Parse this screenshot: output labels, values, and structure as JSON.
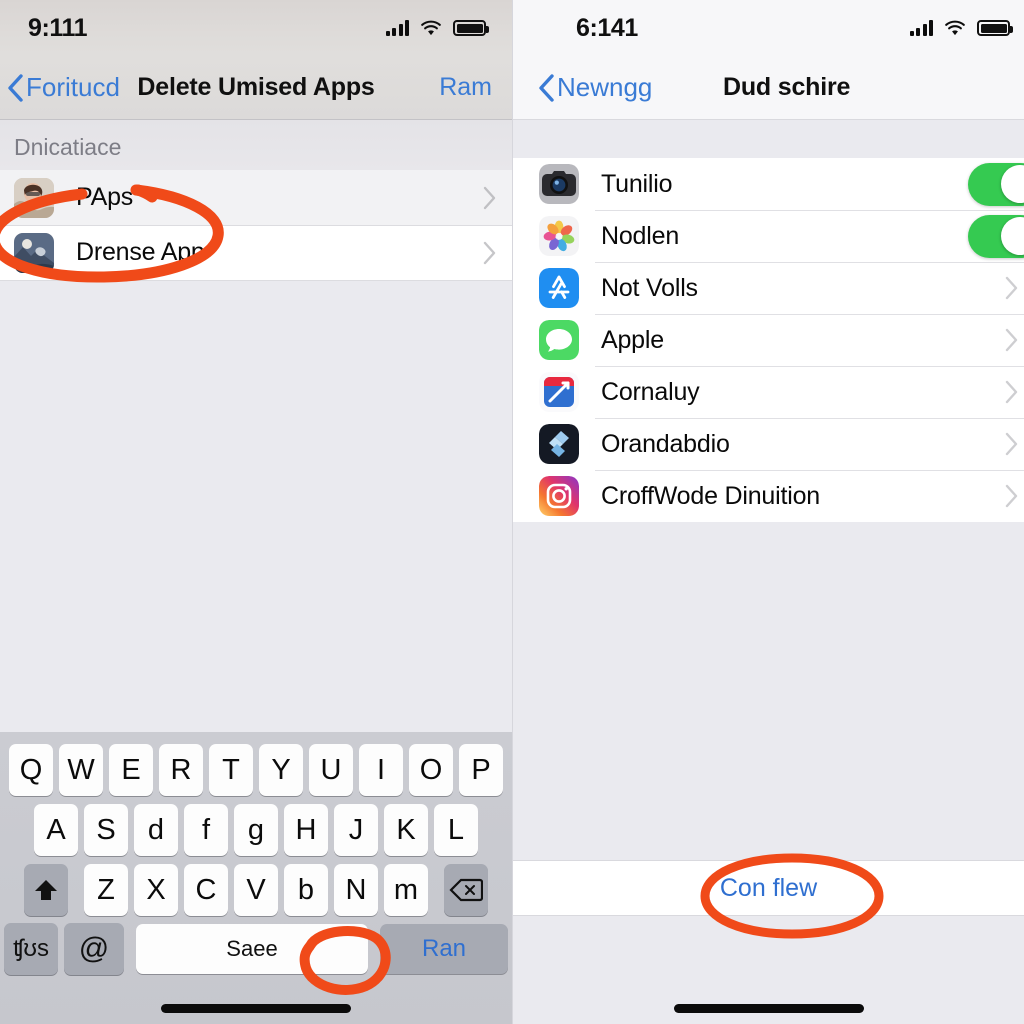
{
  "annotation_color": "#f04a19",
  "left_panel": {
    "status_bar": {
      "time": "9:111",
      "signal_icon": "cellular-bars-icon",
      "wifi_icon": "wifi-icon",
      "battery_icon": "battery-icon"
    },
    "nav": {
      "back_label": "Foritucd",
      "title": "Delete Umised Apps",
      "right_label": "Ram"
    },
    "section_header": "Dnicatiace",
    "rows": [
      {
        "label": "PAps",
        "thumb": "photo-portrait-thumb",
        "accessory": "chevron-right-icon"
      },
      {
        "label": "Drense App",
        "thumb": "photo-scene-thumb",
        "accessory": "chevron-right-icon"
      }
    ],
    "keyboard": {
      "row1": [
        "Q",
        "W",
        "E",
        "R",
        "T",
        "Y",
        "U",
        "I",
        "O",
        "P"
      ],
      "row2": [
        "A",
        "S",
        "d",
        "f",
        "g",
        "H",
        "J",
        "K",
        "L"
      ],
      "row3": [
        "Z",
        "X",
        "C",
        "V",
        "b",
        "N",
        "m"
      ],
      "shift_icon": "shift-up-arrow-icon",
      "delete_icon": "backspace-delete-icon",
      "numbers_key": "ʧʊs",
      "at_key": "@",
      "space_key": "Saee",
      "return_key": "Ran"
    }
  },
  "right_panel": {
    "status_bar": {
      "time": "6:141",
      "signal_icon": "cellular-bars-icon",
      "wifi_icon": "wifi-icon",
      "battery_icon": "battery-icon"
    },
    "nav": {
      "back_label": "Newngg",
      "title": "Dud schire"
    },
    "settings_rows": [
      {
        "label": "Tunilio",
        "icon": "camera-app-icon",
        "accessory": "toggle-on"
      },
      {
        "label": "Nodlen",
        "icon": "photos-app-icon",
        "accessory": "toggle-on"
      },
      {
        "label": "Not Volls",
        "icon": "app-store-icon",
        "accessory": "chevron-right-icon"
      },
      {
        "label": "Apple",
        "icon": "messages-app-icon",
        "accessory": "chevron-right-icon"
      },
      {
        "label": "Cornaluy",
        "icon": "shortcuts-app-icon",
        "accessory": "chevron-right-icon"
      },
      {
        "label": "Orandabdio",
        "icon": "files-dark-app-icon",
        "accessory": "chevron-right-icon"
      },
      {
        "label": "CroffWode Dinuition",
        "icon": "instagram-app-icon",
        "accessory": "chevron-right-icon"
      }
    ],
    "action_label": "Con flew"
  }
}
